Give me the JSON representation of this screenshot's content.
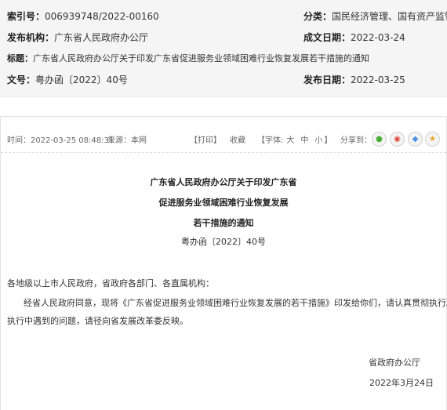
{
  "meta": {
    "index_label": "索引号：",
    "index_value": "006939748/2022-00160",
    "category_label": "分类：",
    "category_value": "国民经济管理、国有资产监管",
    "issuer_label": "发布机构：",
    "issuer_value": "广东省人民政府办公厅",
    "date_written_label": "成文日期：",
    "date_written_value": "2022-03-24",
    "title_label": "标题：",
    "title_value": "广东省人民政府办公厅关于印发广东省促进服务业领域困难行业恢复发展若干措施的通知",
    "docno_label": "文号：",
    "docno_value": "粤办函〔2022〕40号",
    "pubdate_label": "发布日期：",
    "pubdate_value": "2022-03-25"
  },
  "toolbar": {
    "time": "时间：2022-03-25 08:48:31",
    "source": "来源：本网",
    "print": "【打印】",
    "favorite": "收藏",
    "font_open": "【字体:",
    "font_large": "大",
    "font_medium": "中",
    "font_small": "小",
    "font_close": "】",
    "share": "分享到：",
    "icons": [
      "wechat-icon",
      "weibo-icon",
      "qq-icon",
      "star-icon"
    ]
  },
  "article": {
    "title_line1": "广东省人民政府办公厅关于印发广东省",
    "title_line2": "促进服务业领域困难行业恢复发展",
    "title_line3": "若干措施的通知",
    "doc_number": "粤办函〔2022〕40号",
    "addressee": "各地级以上市人民政府，省政府各部门、各直属机构：",
    "para1": "经省人民政府同意，现将《广东省促进服务业领域困难行业恢复发展的若干措施》印发给你们，请认真贯彻执行。",
    "para2": "执行中遇到的问题，请径向省发展改革委反映。",
    "signature": "省政府办公厅",
    "date": "2022年3月24日"
  }
}
